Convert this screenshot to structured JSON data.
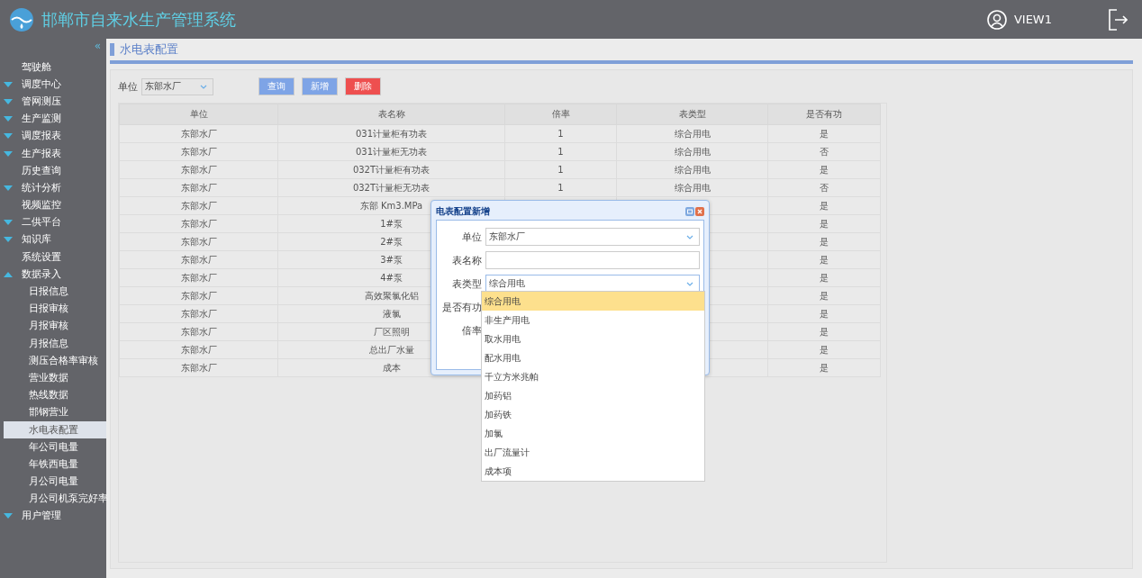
{
  "header": {
    "title": "邯郸市自来水生产管理系统",
    "user": "VIEW1"
  },
  "sidebar": {
    "collapse": "«",
    "items": [
      {
        "label": "驾驶舱"
      },
      {
        "label": "调度中心",
        "expanded": false
      },
      {
        "label": "管网测压",
        "expanded": false
      },
      {
        "label": "生产监测",
        "expanded": false
      },
      {
        "label": "调度报表",
        "expanded": false
      },
      {
        "label": "生产报表",
        "expanded": false
      },
      {
        "label": "历史查询"
      },
      {
        "label": "统计分析",
        "expanded": false
      },
      {
        "label": "视频监控"
      },
      {
        "label": "二供平台",
        "expanded": false
      },
      {
        "label": "知识库",
        "expanded": false
      },
      {
        "label": "系统设置"
      },
      {
        "label": "数据录入",
        "expanded": true,
        "children": [
          {
            "label": "日报信息",
            "selected": false
          },
          {
            "label": "日报审核",
            "selected": false
          },
          {
            "label": "月报审核",
            "selected": false
          },
          {
            "label": "月报信息",
            "selected": false
          },
          {
            "label": "测压合格率审核",
            "selected": false
          },
          {
            "label": "营业数据",
            "selected": false
          },
          {
            "label": "热线数据",
            "selected": false
          },
          {
            "label": "邯钢营业",
            "selected": false
          },
          {
            "label": "水电表配置",
            "selected": true
          },
          {
            "label": "年公司电量",
            "selected": false
          },
          {
            "label": "年铁西电量",
            "selected": false
          },
          {
            "label": "月公司电量",
            "selected": false
          },
          {
            "label": "月公司机泵完好率",
            "selected": false
          }
        ]
      },
      {
        "label": "用户管理",
        "expanded": false
      }
    ]
  },
  "page_title": "水电表配置",
  "filter": {
    "label": "单位",
    "value": "东部水厂"
  },
  "buttons": [
    {
      "label": "查询",
      "kind": "primary"
    },
    {
      "label": "新增",
      "kind": "primary"
    },
    {
      "label": "删除",
      "kind": "danger"
    }
  ],
  "table": {
    "columns": [
      "单位",
      "表名称",
      "倍率",
      "表类型",
      "是否有功"
    ],
    "rows": [
      [
        "东部水厂",
        "031计量柜有功表",
        "1",
        "综合用电",
        "是"
      ],
      [
        "东部水厂",
        "031计量柜无功表",
        "1",
        "综合用电",
        "否"
      ],
      [
        "东部水厂",
        "032T计量柜有功表",
        "1",
        "综合用电",
        "是"
      ],
      [
        "东部水厂",
        "032T计量柜无功表",
        "1",
        "综合用电",
        "否"
      ],
      [
        "东部水厂",
        "东部 Km3.MPa",
        null,
        null,
        "是"
      ],
      [
        "东部水厂",
        "1#泵",
        null,
        null,
        "是"
      ],
      [
        "东部水厂",
        "2#泵",
        null,
        null,
        "是"
      ],
      [
        "东部水厂",
        "3#泵",
        null,
        null,
        "是"
      ],
      [
        "东部水厂",
        "4#泵",
        null,
        null,
        "是"
      ],
      [
        "东部水厂",
        "高效聚氯化铝",
        null,
        null,
        "是"
      ],
      [
        "东部水厂",
        "液氯",
        null,
        null,
        "是"
      ],
      [
        "东部水厂",
        "厂区照明",
        null,
        null,
        "是"
      ],
      [
        "东部水厂",
        "总出厂水量",
        null,
        null,
        "是"
      ],
      [
        "东部水厂",
        "成本",
        null,
        null,
        "是"
      ]
    ]
  },
  "dialog": {
    "title": "电表配置新增",
    "fields": [
      {
        "label": "单位",
        "kind": "select",
        "value": "东部水厂"
      },
      {
        "label": "表名称",
        "kind": "text"
      },
      {
        "label": "表类型",
        "kind": "select",
        "value": "综合用电",
        "expanded": true
      },
      {
        "label": "是否有功",
        "kind": "hidden"
      },
      {
        "label": "倍率",
        "kind": "hidden"
      }
    ],
    "options": [
      {
        "label": "综合用电",
        "selected": true
      },
      {
        "label": "非生产用电",
        "selected": false
      },
      {
        "label": "取水用电",
        "selected": false
      },
      {
        "label": "配水用电",
        "selected": false
      },
      {
        "label": "千立方米兆帕",
        "selected": false
      },
      {
        "label": "加药铝",
        "selected": false
      },
      {
        "label": "加药铁",
        "selected": false
      },
      {
        "label": "加氯",
        "selected": false
      },
      {
        "label": "出厂流量计",
        "selected": false
      },
      {
        "label": "成本项",
        "selected": false
      }
    ]
  }
}
